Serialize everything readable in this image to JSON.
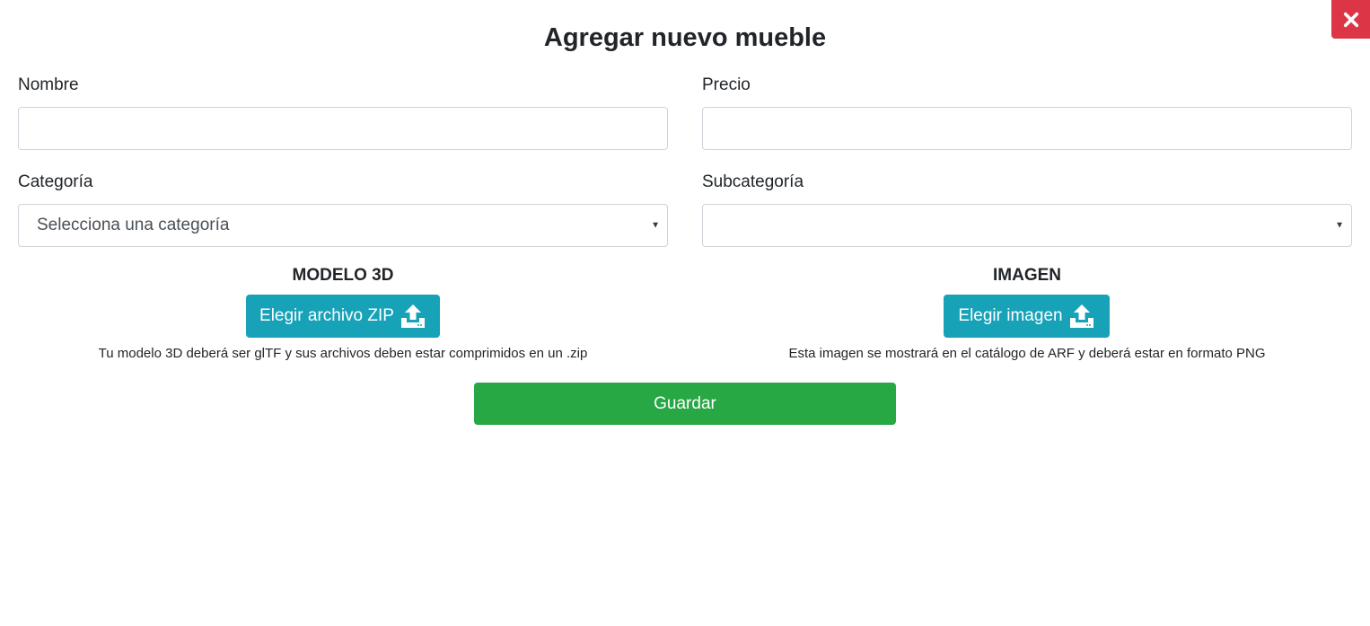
{
  "modal": {
    "title": "Agregar nuevo mueble",
    "close_icon": "close-icon"
  },
  "fields": {
    "nombre": {
      "label": "Nombre",
      "value": "",
      "placeholder": ""
    },
    "precio": {
      "label": "Precio",
      "value": "",
      "placeholder": ""
    },
    "categoria": {
      "label": "Categoría",
      "selected": "Selecciona una categoría"
    },
    "subcategoria": {
      "label": "Subcategoría",
      "selected": ""
    }
  },
  "model3d": {
    "title": "MODELO 3D",
    "button_label": "Elegir archivo ZIP",
    "icon": "upload-icon",
    "help": "Tu modelo 3D deberá ser glTF y sus archivos deben estar comprimidos en un .zip"
  },
  "image": {
    "title": "IMAGEN",
    "button_label": "Elegir imagen",
    "icon": "upload-icon",
    "help": "Esta imagen se mostrará en el catálogo de ARF y deberá estar en formato PNG"
  },
  "actions": {
    "save_label": "Guardar"
  },
  "colors": {
    "close": "#dc3545",
    "upload": "#17a2b8",
    "save": "#28a745",
    "border": "#ced4da"
  }
}
